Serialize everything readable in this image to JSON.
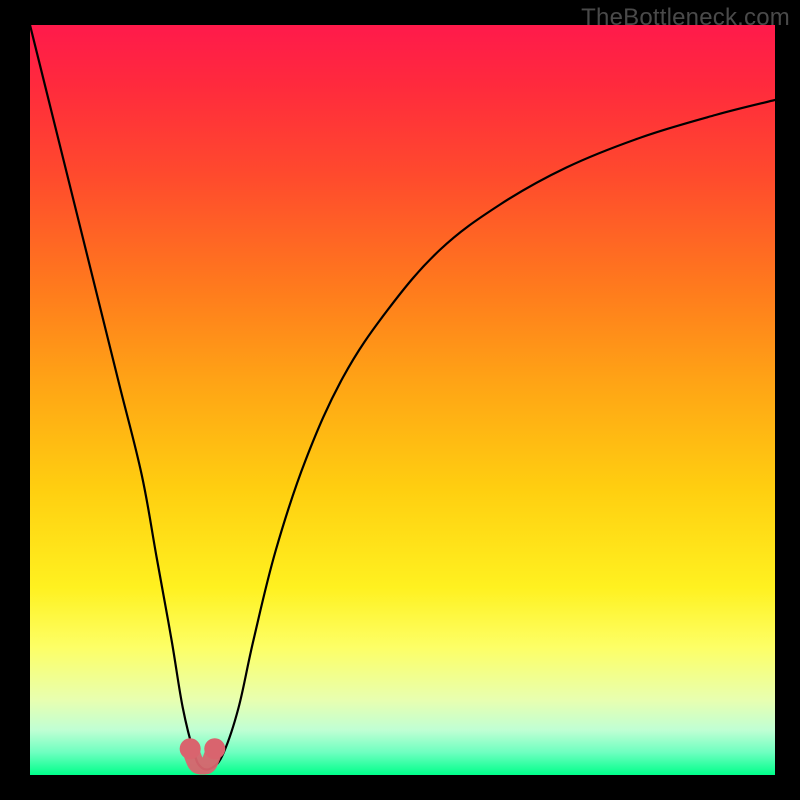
{
  "watermark": "TheBottleneck.com",
  "chart_data": {
    "type": "line",
    "title": "",
    "xlabel": "",
    "ylabel": "",
    "xlim": [
      0,
      100
    ],
    "ylim": [
      0,
      100
    ],
    "series": [
      {
        "name": "bottleneck-curve",
        "x": [
          0,
          3,
          6,
          9,
          12,
          15,
          17,
          19,
          20.5,
          22,
          23,
          24.5,
          26,
          28,
          30,
          33,
          37,
          42,
          48,
          55,
          63,
          72,
          82,
          92,
          100
        ],
        "y": [
          100,
          88,
          76,
          64,
          52,
          40,
          29,
          18,
          9,
          3,
          1,
          1,
          3,
          9,
          18,
          30,
          42,
          53,
          62,
          70,
          76,
          81,
          85,
          88,
          90
        ]
      }
    ],
    "highlight": {
      "name": "optimal-range",
      "x": [
        21.5,
        22.3,
        23.2,
        24.0,
        24.8
      ],
      "y": [
        3.5,
        1.5,
        1.2,
        1.5,
        3.5
      ]
    },
    "gradient_stops": [
      {
        "pos": 0.0,
        "color": "#ff1a4b"
      },
      {
        "pos": 0.2,
        "color": "#ff4a2d"
      },
      {
        "pos": 0.48,
        "color": "#ffa515"
      },
      {
        "pos": 0.75,
        "color": "#fff120"
      },
      {
        "pos": 0.9,
        "color": "#e8ffb0"
      },
      {
        "pos": 1.0,
        "color": "#00ff8a"
      }
    ]
  }
}
